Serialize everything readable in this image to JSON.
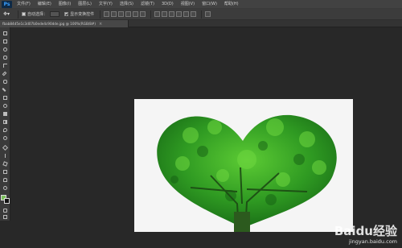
{
  "app": {
    "logo": "Ps"
  },
  "menu": [
    "文件(F)",
    "编辑(E)",
    "图像(I)",
    "图层(L)",
    "文字(Y)",
    "选择(S)",
    "滤镜(T)",
    "3D(D)",
    "视图(V)",
    "窗口(W)",
    "帮助(H)"
  ],
  "options": {
    "auto_select_label": "自动选择：",
    "layer_select_value": "图层",
    "show_transform_label": "显示变换控件"
  },
  "document": {
    "tab_title": "fbab84d5e1c3d07b0ede4c90dde.jpg @ 100%(RGB/8#)",
    "close_glyph": "×"
  },
  "colors": {
    "foreground": "#7abf5a",
    "background": "#111111",
    "tree_dark": "#1d6e1b",
    "tree_light": "#56c42f"
  },
  "watermark": {
    "logo_text": "Baidu经验",
    "url": "jingyan.baidu.com"
  }
}
